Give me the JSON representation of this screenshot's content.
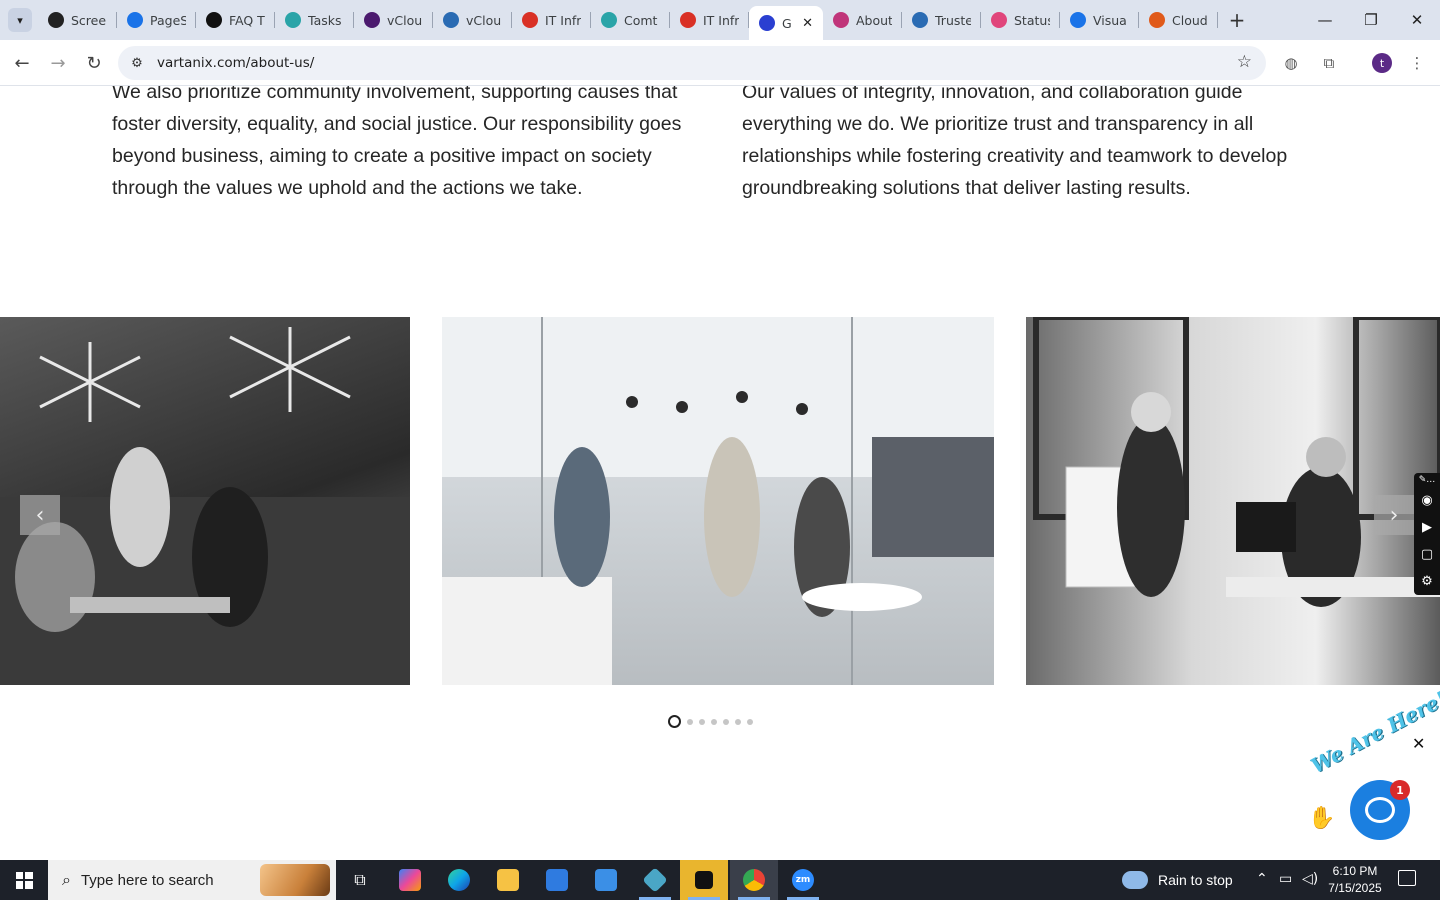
{
  "browser": {
    "tabs": [
      {
        "title": "Screen",
        "favicon": "screencast-icon",
        "color": "#222222"
      },
      {
        "title": "PageS",
        "favicon": "rainbow-icon",
        "color": "#1a73e8"
      },
      {
        "title": "FAQ T",
        "favicon": "openai-icon",
        "color": "#111111"
      },
      {
        "title": "Tasks",
        "favicon": "tasks-icon",
        "color": "#2aa4a8"
      },
      {
        "title": "vClou",
        "favicon": "v-icon",
        "color": "#4b1a6e"
      },
      {
        "title": "vClou",
        "favicon": "check-v-icon",
        "color": "#2a6bb3"
      },
      {
        "title": "IT Infr",
        "favicon": "tag-icon",
        "color": "#d93025"
      },
      {
        "title": "Comt",
        "favicon": "circle-icon",
        "color": "#2aa4a8"
      },
      {
        "title": "IT Infr",
        "favicon": "tag-icon",
        "color": "#d93025"
      },
      {
        "title": "G",
        "favicon": "x-logo-icon",
        "color": "#2a3fd1",
        "active": true
      },
      {
        "title": "About",
        "favicon": "flower-icon",
        "color": "#c0357a"
      },
      {
        "title": "Truste",
        "favicon": "scales-icon",
        "color": "#2a6bb3"
      },
      {
        "title": "Status",
        "favicon": "pen-icon",
        "color": "#e0457b"
      },
      {
        "title": "Visua",
        "favicon": "pulse-icon",
        "color": "#1a73e8"
      },
      {
        "title": "Cloud",
        "favicon": "slash-icon",
        "color": "#e05a1a"
      }
    ],
    "new_tab_label": "+",
    "url": "vartanix.com/about-us/",
    "profile_initial": "t"
  },
  "content": {
    "left_paragraph": "We also prioritize community involvement, supporting causes that foster diversity, equality, and social justice. Our responsibility goes beyond business, aiming to create a positive impact on society through the values we uphold and the actions we take.",
    "right_paragraph": "Our values of integrity, innovation, and collaboration guide everything we do. We prioritize trust and transparency in all relationships while fostering creativity and teamwork to develop groundbreaking solutions that deliver lasting results.",
    "carousel": {
      "prev_label": "‹",
      "next_label": "›",
      "slide_count": 7,
      "active_index": 0
    },
    "chat": {
      "tagline": "We Are Here!",
      "badge_count": "1",
      "close_label": "✕"
    }
  },
  "taskbar": {
    "search_placeholder": "Type here to search",
    "weather_text": "Rain to stop",
    "time": "6:10 PM",
    "date": "7/15/2025"
  }
}
